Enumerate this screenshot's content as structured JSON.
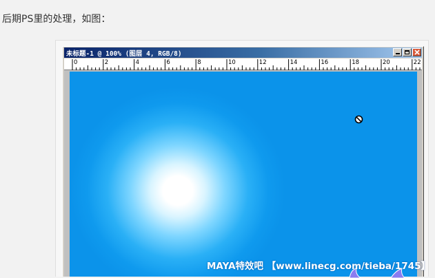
{
  "article": {
    "intro_text": "后期PS里的处理，如图："
  },
  "window": {
    "title": "未标题-1 @ 100% (图层 4, RGB/8)",
    "controls": [
      "minimize-icon",
      "maximize-icon",
      "close-icon"
    ]
  },
  "ruler": {
    "labels": [
      "0",
      "2",
      "4",
      "6",
      "8",
      "10",
      "12",
      "14",
      "16",
      "18",
      "20",
      "22"
    ]
  },
  "canvas": {
    "cursor_icon": "no-entry-cursor-icon",
    "colors": {
      "background": "#0b93ea",
      "glow": "#ffffff"
    }
  },
  "watermark": {
    "text": "MAYA特效吧 【www.linecg.com/tieba/1745】"
  }
}
